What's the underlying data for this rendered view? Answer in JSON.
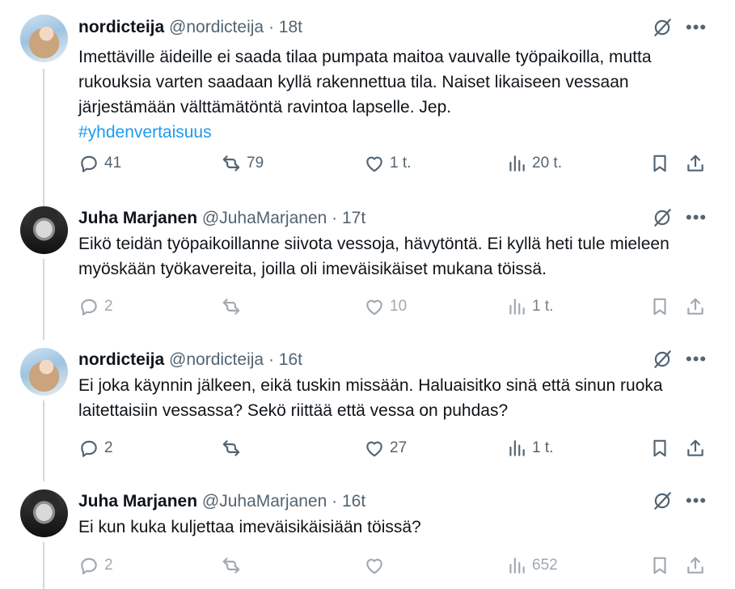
{
  "tweets": [
    {
      "name": "nordicteija",
      "handle": "@nordicteija",
      "time": "· 18t",
      "text": "Imettäville äideille ei saada tilaa pumpata maitoa vauvalle työpaikoilla, mutta rukouksia varten saadaan kyllä rakennettua tila. Naiset likaiseen vessaan järjestämään välttämätöntä ravintoa lapselle. Jep.",
      "hashtag": "#yhdenvertaisuus",
      "replies": "41",
      "retweets": "79",
      "likes": "1 t.",
      "views": "20 t."
    },
    {
      "name": "Juha Marjanen",
      "handle": "@JuhaMarjanen",
      "time": "· 17t",
      "text": "Eikö teidän työpaikoillanne siivota vessoja, hävytöntä. Ei kyllä heti tule mieleen myöskään työkavereita, joilla oli imeväisikäiset mukana töissä.",
      "replies": "2",
      "retweets": "",
      "likes": "10",
      "views": "1 t."
    },
    {
      "name": "nordicteija",
      "handle": "@nordicteija",
      "time": "· 16t",
      "text": "Ei joka käynnin jälkeen, eikä tuskin missään. Haluaisitko sinä että sinun ruoka laitettaisiin vessassa? Sekö riittää että vessa on puhdas?",
      "replies": "2",
      "retweets": "",
      "likes": "27",
      "views": "1 t."
    },
    {
      "name": "Juha Marjanen",
      "handle": "@JuhaMarjanen",
      "time": "· 16t",
      "text": "Ei kun kuka kuljettaa imeväisikäisiään töissä?",
      "replies": "2",
      "retweets": "",
      "likes": "",
      "views": "652"
    }
  ],
  "icons": {
    "reply": "reply-icon",
    "retweet": "retweet-icon",
    "like": "heart-icon",
    "views": "views-icon",
    "bookmark": "bookmark-icon",
    "share": "share-icon",
    "grok": "grok-icon",
    "more": "more-icon"
  },
  "colors": {
    "link": "#1d9bf0",
    "muted": "#536471",
    "text": "#0f1419",
    "thread": "#cfd9de"
  }
}
